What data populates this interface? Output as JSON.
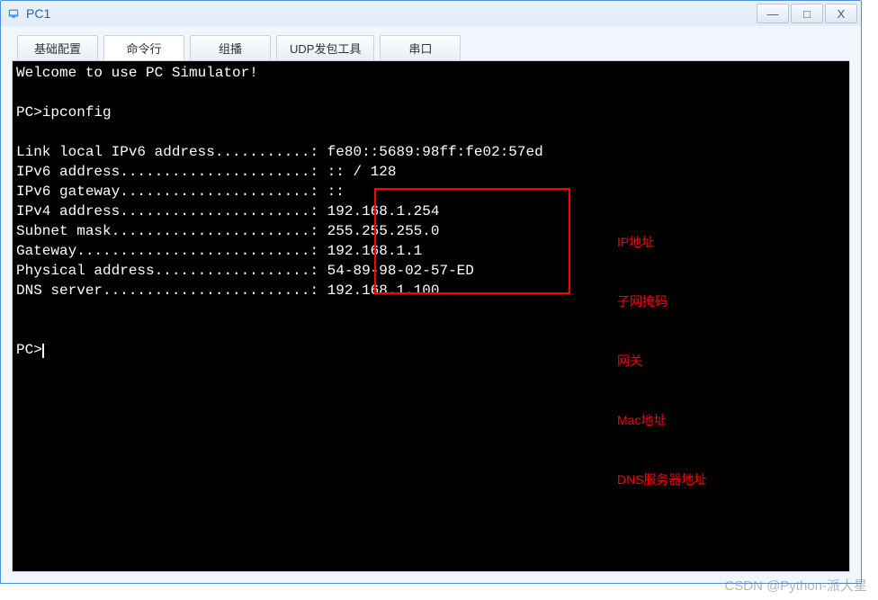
{
  "window": {
    "title": "PC1",
    "buttons": {
      "minimize": "—",
      "maximize": "□",
      "close": "X"
    }
  },
  "tabs": [
    {
      "label": "基础配置",
      "active": false
    },
    {
      "label": "命令行",
      "active": true
    },
    {
      "label": "组播",
      "active": false
    },
    {
      "label": "UDP发包工具",
      "active": false
    },
    {
      "label": "串口",
      "active": false
    }
  ],
  "terminal": {
    "welcome": "Welcome to use PC Simulator!",
    "prompt1": "PC>ipconfig",
    "blank": "",
    "lines": [
      {
        "label": "Link local IPv6 address...........: ",
        "value": "fe80::5689:98ff:fe02:57ed"
      },
      {
        "label": "IPv6 address......................: ",
        "value": ":: / 128"
      },
      {
        "label": "IPv6 gateway......................: ",
        "value": "::"
      },
      {
        "label": "IPv4 address......................: ",
        "value": "192.168.1.254"
      },
      {
        "label": "Subnet mask.......................: ",
        "value": "255.255.255.0"
      },
      {
        "label": "Gateway...........................: ",
        "value": "192.168.1.1"
      },
      {
        "label": "Physical address..................: ",
        "value": "54-89-98-02-57-ED"
      },
      {
        "label": "DNS server........................: ",
        "value": "192.168.1.100"
      }
    ],
    "prompt2": "PC>"
  },
  "annotations": [
    "IP地址",
    "子网掩码",
    "网关",
    "Mac地址",
    "DNS服务器地址"
  ],
  "watermark": "CSDN @Python-派大星",
  "colors": {
    "accent": "#4a90d9",
    "highlight": "#ff0000"
  }
}
